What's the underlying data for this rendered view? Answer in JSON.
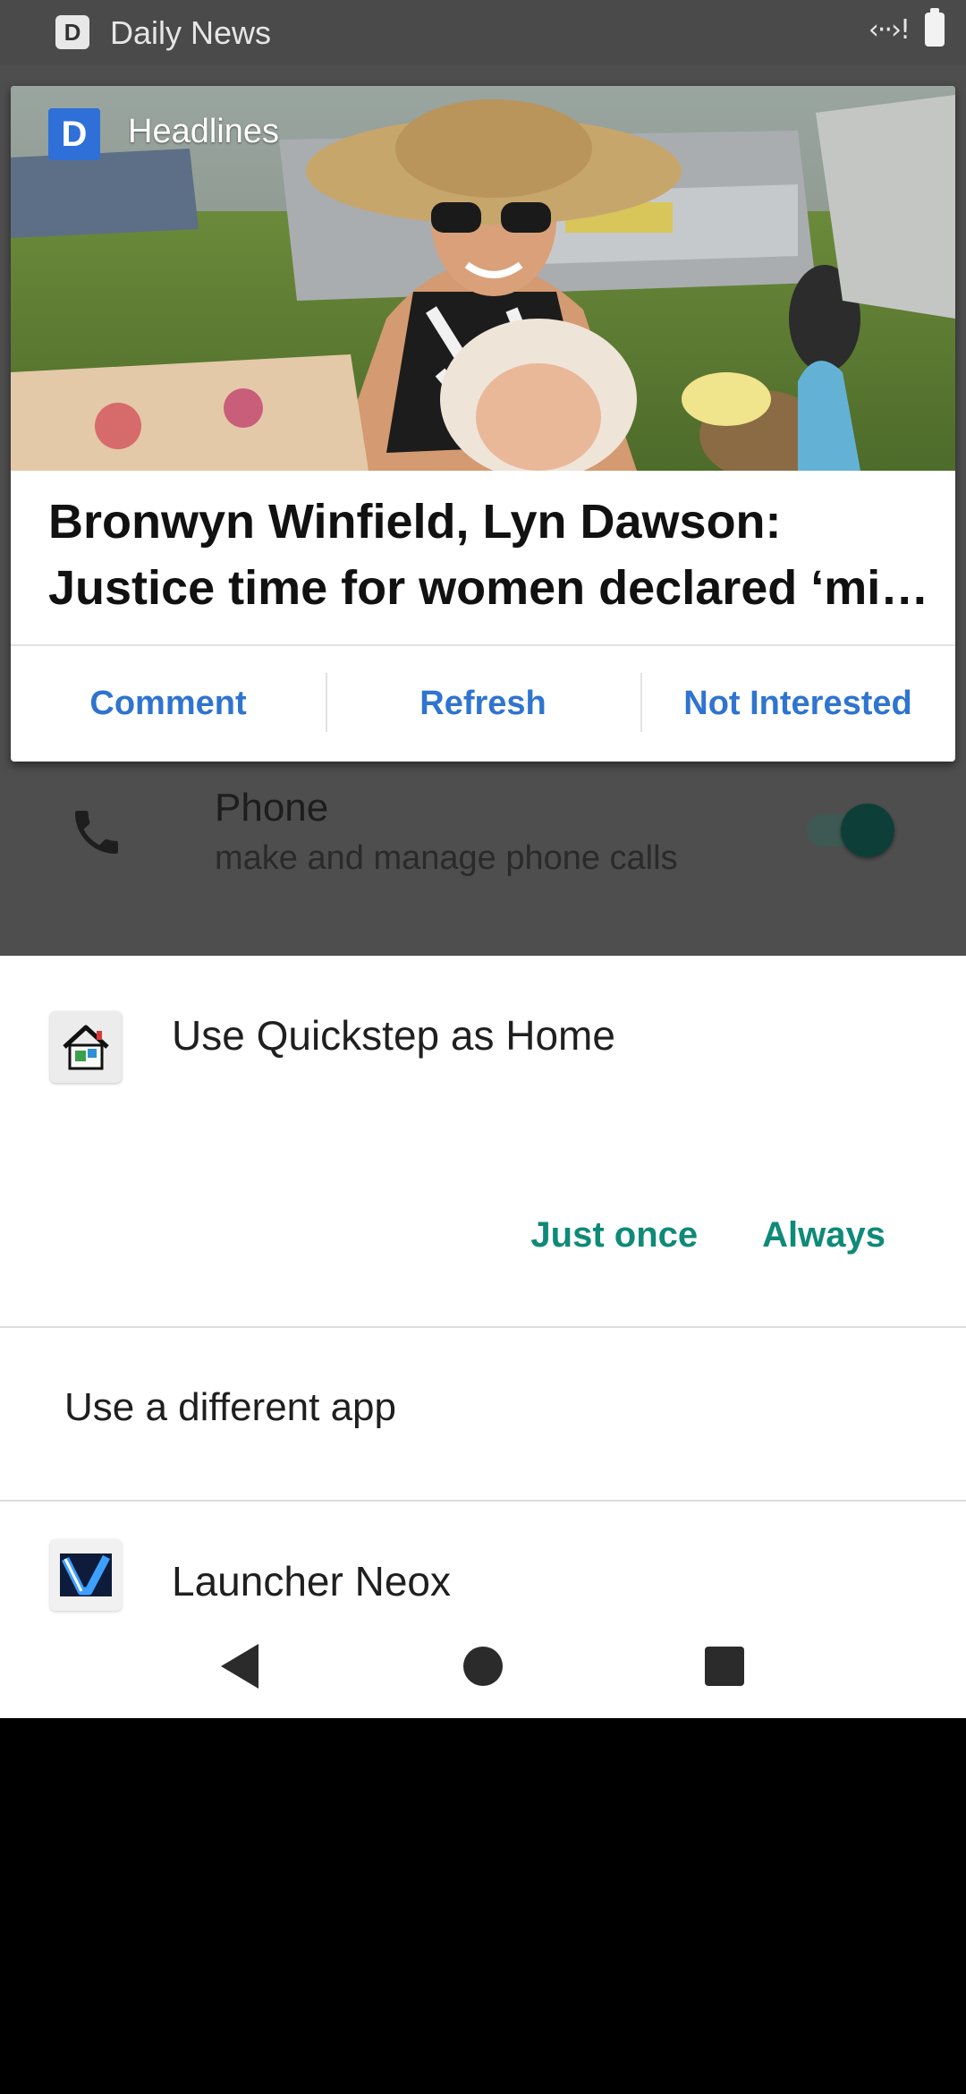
{
  "status_bar": {
    "app_icon_letter": "D",
    "app_name": "Daily News",
    "data_indicator": "‹··›!",
    "icons": [
      "daily-news-app-icon",
      "data-activity-icon",
      "battery-icon"
    ]
  },
  "notification": {
    "app_badge_letter": "D",
    "app_name": "Headlines",
    "headline_line1": "Bronwyn Winfield, Lyn Dawson:",
    "headline_line2": "Justice time for women declared ‘mi…",
    "actions": [
      {
        "label": "Comment"
      },
      {
        "label": "Refresh"
      },
      {
        "label": "Not Interested"
      }
    ],
    "action_color": "#2f74d0"
  },
  "background_setting": {
    "title": "Phone",
    "subtitle": "make and manage phone calls",
    "toggle_on": true,
    "icon": "phone-icon"
  },
  "chooser": {
    "title": "Use Quickstep as Home",
    "app_icon": "house-icon",
    "buttons": {
      "just_once": "Just once",
      "always": "Always"
    },
    "button_color": "#0f8a78",
    "subheader": "Use a different app",
    "other_apps": [
      {
        "label": "Launcher Neox",
        "icon": "launcher-neox-icon"
      }
    ]
  },
  "nav_bar": {
    "buttons": [
      "back-icon",
      "home-icon",
      "recents-icon"
    ]
  }
}
